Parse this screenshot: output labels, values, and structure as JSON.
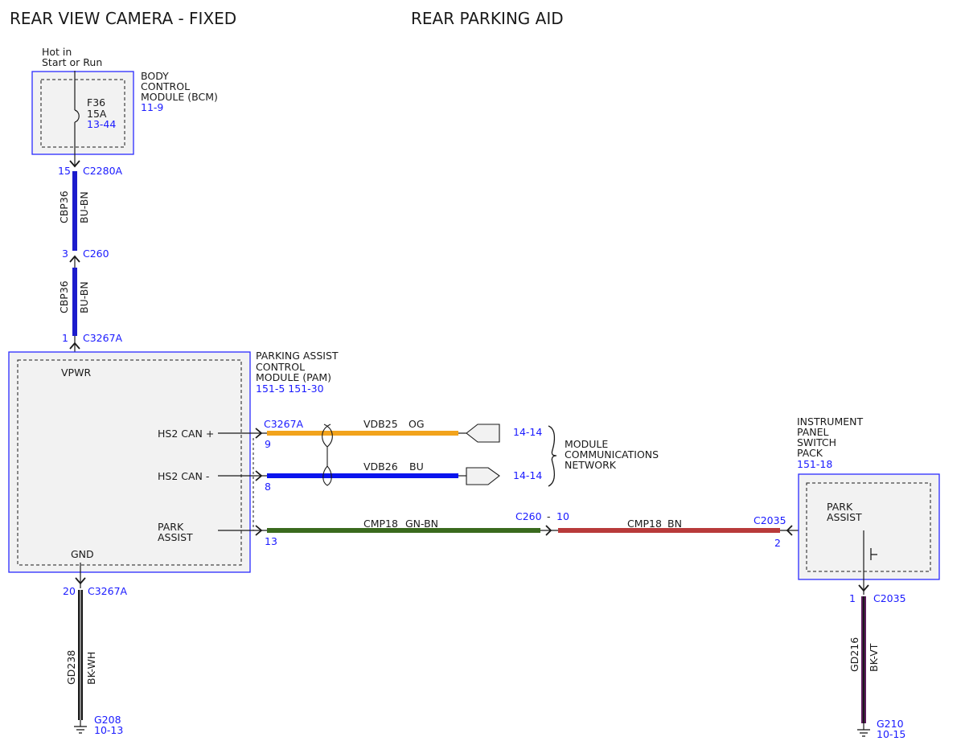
{
  "titles": {
    "left": "REAR VIEW CAMERA - FIXED",
    "center": "REAR PARKING AID"
  },
  "colors": {
    "module_border": "#2b2bff",
    "module_fill": "#f2f2f2",
    "ref_text": "#1a1aff",
    "wire_bu_bn": "#1c1ccc",
    "wire_og": "#f2a31c",
    "wire_bu": "#0a14ee",
    "wire_gn_bn": "#3a6a1e",
    "wire_bn": "#b83a3a",
    "wire_bk_wh": "#1a1a1a",
    "wire_bk_vt": "#5a1a5a"
  },
  "bcm": {
    "power_label": [
      "Hot in",
      "Start or Run"
    ],
    "name": [
      "BODY",
      "CONTROL",
      "MODULE (BCM)"
    ],
    "ref": "11-9",
    "fuse": {
      "id": "F36",
      "rating": "15A",
      "ref": "13-44"
    },
    "pin": "15",
    "connector": "C2280A"
  },
  "wire_bcm_c260": {
    "circuit": "CBP36",
    "color": "BU-BN"
  },
  "c260_upper": {
    "pin": "3",
    "connector": "C260"
  },
  "wire_c260_pam": {
    "circuit": "CBP36",
    "color": "BU-BN"
  },
  "pam_top": {
    "pin": "1",
    "connector": "C3267A"
  },
  "pam": {
    "name": [
      "PARKING ASSIST",
      "CONTROL",
      "MODULE (PAM)"
    ],
    "refs": "151-5  151-30",
    "pins": {
      "vpwr": "VPWR",
      "hs2_can_plus": "HS2 CAN +",
      "hs2_can_minus": "HS2 CAN -",
      "park_assist": [
        "PARK",
        "ASSIST"
      ],
      "gnd": "GND"
    },
    "connector": "C3267A",
    "pin_can_plus": "9",
    "pin_can_minus": "8",
    "pin_park": "13"
  },
  "can_plus_wire": {
    "circuit": "VDB25",
    "color": "OG",
    "ref": "14-14"
  },
  "can_minus_wire": {
    "circuit": "VDB26",
    "color": "BU",
    "ref": "14-14"
  },
  "network": [
    "MODULE",
    "COMMUNICATIONS",
    "NETWORK"
  ],
  "park_wire_left": {
    "circuit": "CMP18",
    "color": "GN-BN"
  },
  "inline_connector": {
    "connector": "C260",
    "dash": "-",
    "pin": "10"
  },
  "park_wire_right": {
    "circuit": "CMP18",
    "color": "BN"
  },
  "ipsp": {
    "name": [
      "INSTRUMENT",
      "PANEL",
      "SWITCH",
      "PACK"
    ],
    "ref": "151-18",
    "switch_label": [
      "PARK",
      "ASSIST"
    ],
    "connector_in": "C2035",
    "pin_in": "2",
    "pin_out": "1",
    "connector_out": "C2035"
  },
  "ground_left": {
    "pin": "20",
    "connector": "C3267A",
    "circuit": "GD238",
    "color": "BK-WH",
    "ground": "G208",
    "ref": "10-13"
  },
  "ground_right": {
    "circuit": "GD216",
    "color": "BK-VT",
    "ground": "G210",
    "ref": "10-15"
  }
}
